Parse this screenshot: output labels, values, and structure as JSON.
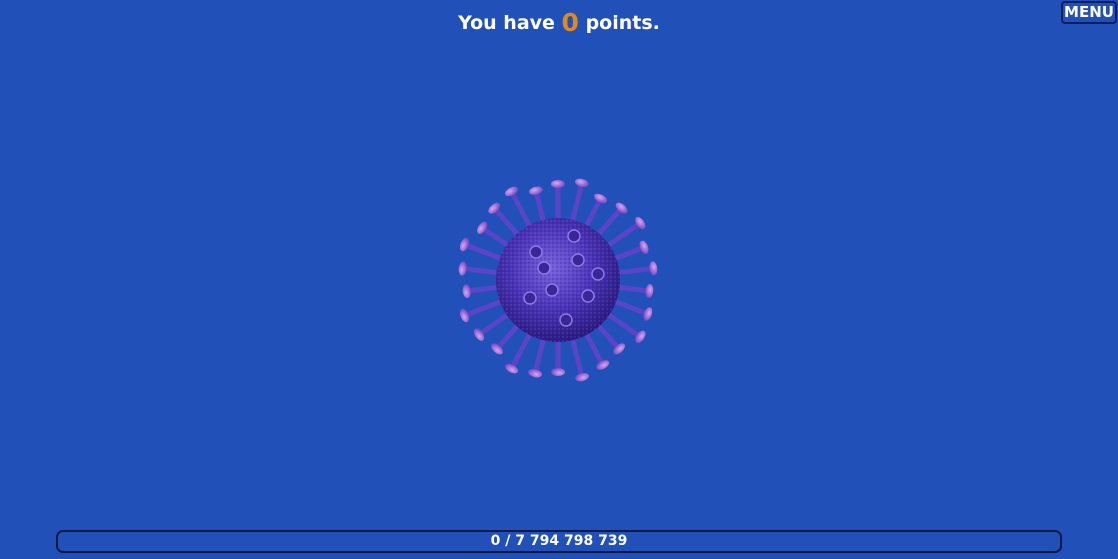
{
  "header": {
    "prefix": "You have",
    "points": "0",
    "suffix": "points."
  },
  "menu": {
    "label": "MENU"
  },
  "progress": {
    "label": "0 / 7 794 798 739",
    "current": 0,
    "total": 7794798739
  },
  "colors": {
    "background": "#2150b9",
    "points_accent": "#e08a1c",
    "virus_body": "#5a3fc8",
    "virus_tips": "#b77ad8"
  },
  "icons": {
    "virus": "coronavirus-icon"
  }
}
